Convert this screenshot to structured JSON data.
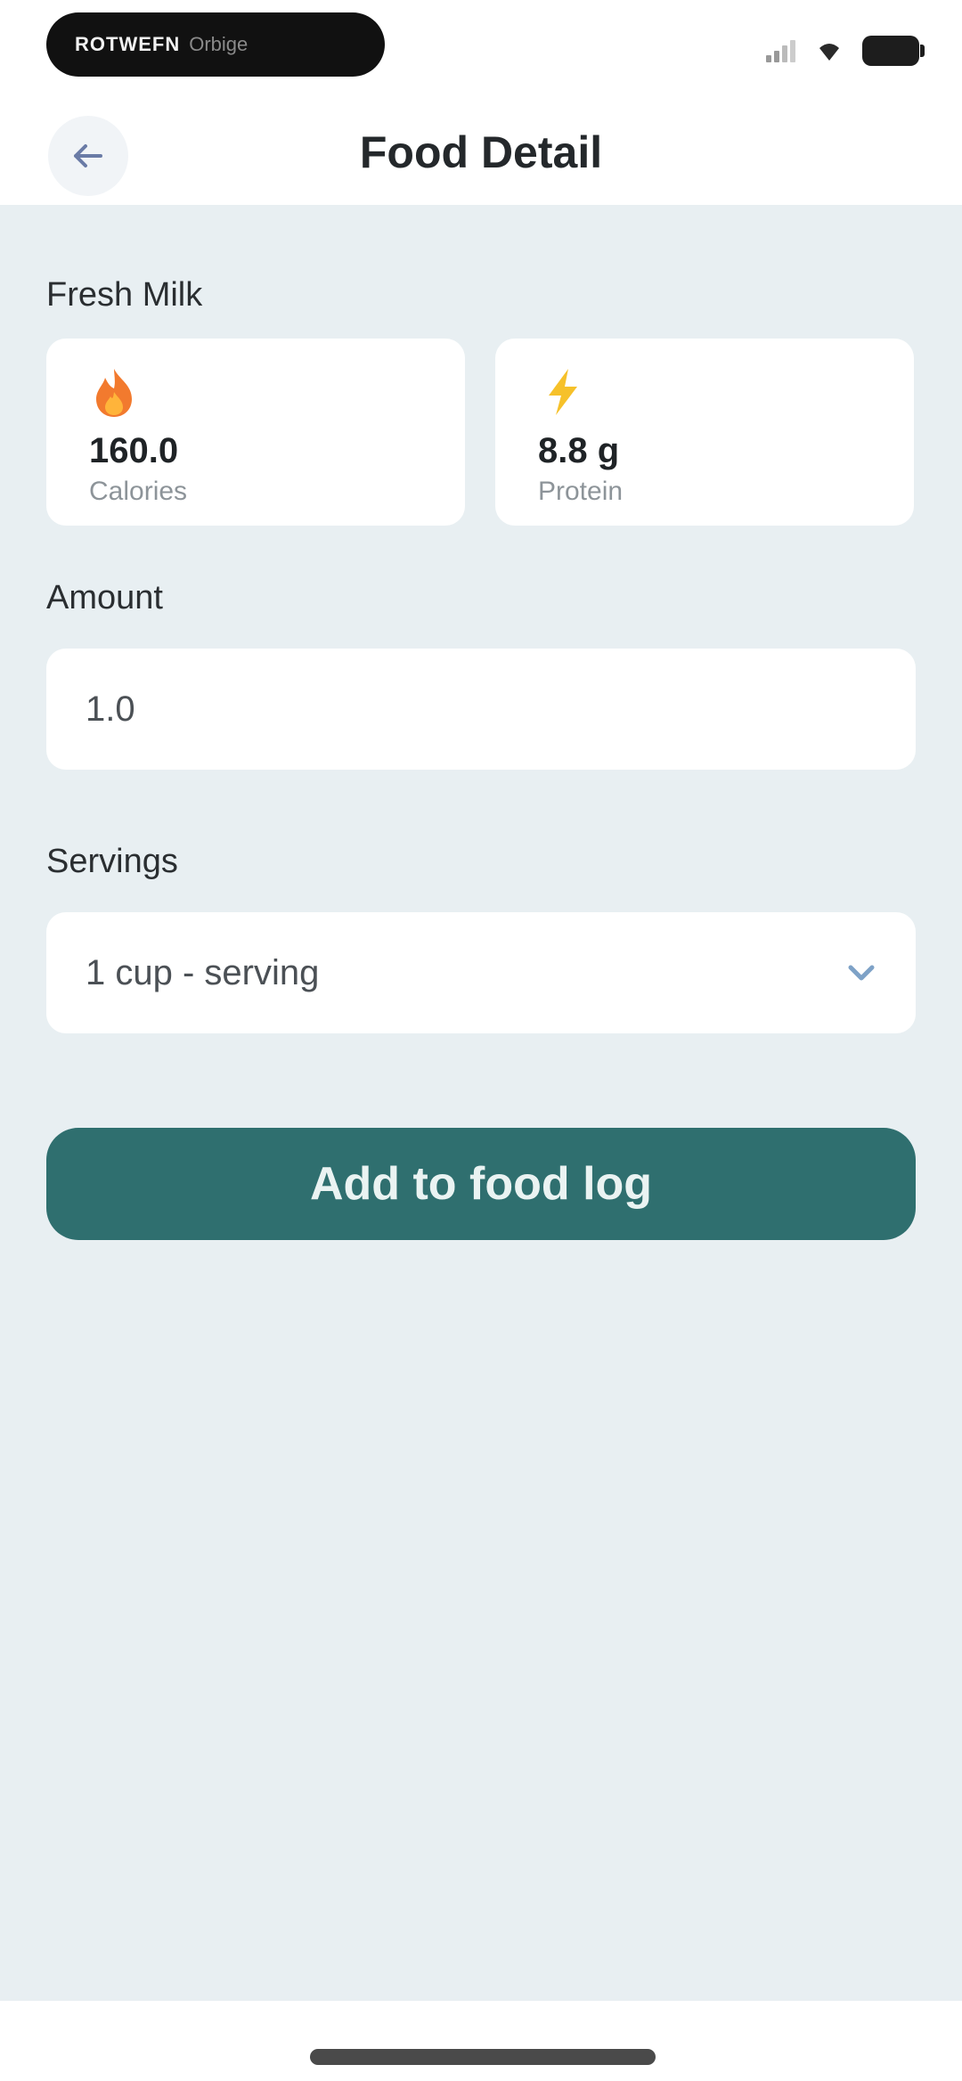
{
  "status_bar": {
    "pill_text": "ROTWEFN",
    "pill_sub": "Orbige"
  },
  "header": {
    "title": "Food Detail"
  },
  "food": {
    "name": "Fresh Milk"
  },
  "stats": {
    "calories": {
      "value": "160.0",
      "label": "Calories",
      "icon": "fire-icon"
    },
    "protein": {
      "value": "8.8 g",
      "label": "Protein",
      "icon": "lightning-icon"
    }
  },
  "amount": {
    "label": "Amount",
    "value": "1.0"
  },
  "servings": {
    "label": "Servings",
    "value": "1 cup - serving"
  },
  "actions": {
    "add_label": "Add to food log"
  },
  "colors": {
    "accent": "#2f6f6f",
    "background": "#e8eff2",
    "card": "#ffffff"
  }
}
